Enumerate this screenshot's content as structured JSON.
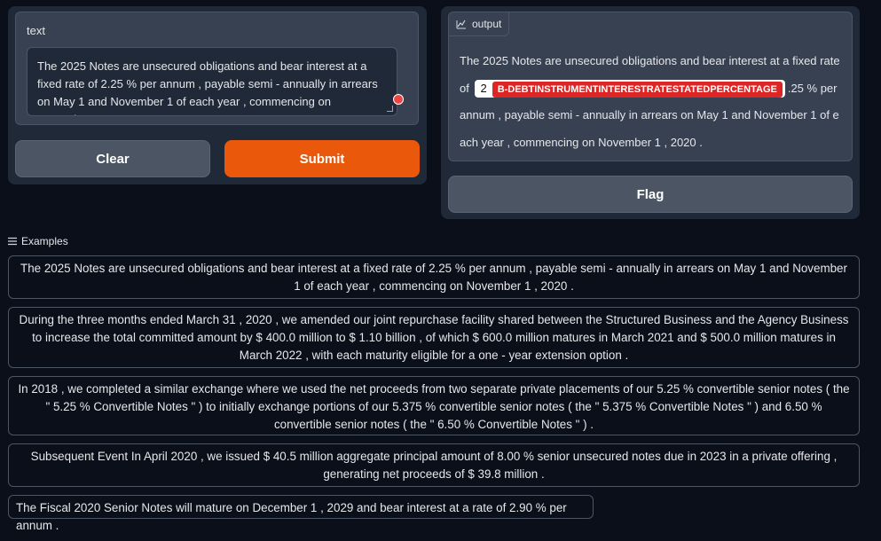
{
  "input": {
    "label": "text",
    "value": "The 2025 Notes are unsecured obligations and bear interest at a fixed rate of 2.25 % per annum , payable semi - annually in arrears on May 1 and November 1 of each year , commencing on November 1 , 2020 ."
  },
  "buttons": {
    "clear": "Clear",
    "submit": "Submit",
    "flag": "Flag"
  },
  "output": {
    "tab_label": "output",
    "before": "The 2025 Notes are unsecured obligations and bear interest at a fixed rate of ",
    "entity_text": "2",
    "entity_label": "B-DEBTINSTRUMENTINTERESTRATESTATEDPERCENTAGE",
    "after": ".25 % per annum , payable semi - annually in arrears on May 1 and November 1 of each year , commencing on November 1 , 2020 ."
  },
  "examples": {
    "header": "Examples",
    "items": [
      "The 2025 Notes are unsecured obligations and bear interest at a fixed rate of 2.25 % per annum , payable semi - annually in arrears on May 1 and November 1 of each year , commencing on November 1 , 2020 .",
      "During the three months ended March 31 , 2020 , we amended our joint repurchase facility shared between the Structured Business and the Agency Business to increase the total committed amount by $ 400.0 million to $ 1.10 billion , of which $ 600.0 million matures in March 2021 and $ 500.0 million matures in March 2022 , with each maturity eligible for a one - year extension option .",
      "In 2018 , we completed a similar exchange where we used the net proceeds from two separate private placements of our 5.25 % convertible senior notes ( the \" 5.25 % Convertible Notes \" ) to initially exchange portions of our 5.375 % convertible senior notes ( the \" 5.375 % Convertible Notes \" ) and 6.50 % convertible senior notes ( the \" 6.50 % Convertible Notes \" ) .",
      "Subsequent Event In April 2020 , we issued $ 40.5 million aggregate principal amount of 8.00 % senior unsecured notes due in 2023 in a private offering , generating net proceeds of $ 39.8 million .",
      "The Fiscal 2020 Senior Notes will mature on December 1 , 2029 and bear interest at a rate of 2.90 % per annum ."
    ]
  }
}
